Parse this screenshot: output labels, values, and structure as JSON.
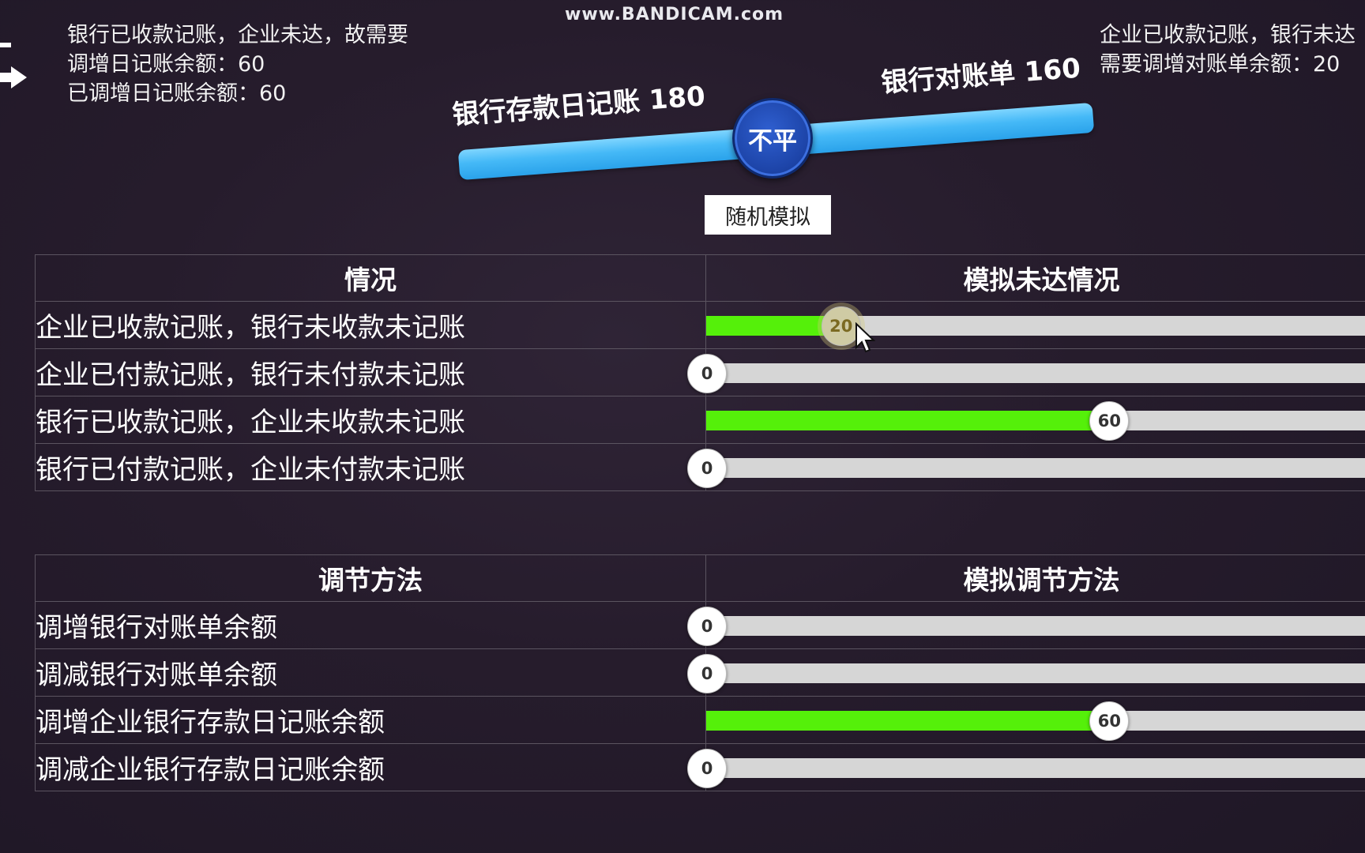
{
  "watermark": "www.BANDICAM.com",
  "info_left": {
    "line1": "银行已收款记账，企业未达，故需要",
    "line2": "调增日记账余额：60",
    "line3": "已调增日记账余额：60"
  },
  "info_right": {
    "line1": "企业已收款记账，银行未达",
    "line2": "需要调增对账单余额：20"
  },
  "scale": {
    "left_label": "银行存款日记账 180",
    "right_label": "银行对账单 160",
    "status": "不平"
  },
  "random_button": "随机模拟",
  "situation_panel": {
    "header_left": "情况",
    "header_right": "模拟未达情况",
    "slider_max": 100,
    "rows": [
      {
        "label": "企业已收款记账，银行未收款未记账",
        "value": 20,
        "value_label": "20"
      },
      {
        "label": "企业已付款记账，银行未付款未记账",
        "value": 0,
        "value_label": "0"
      },
      {
        "label": "银行已收款记账，企业未收款未记账",
        "value": 60,
        "value_label": "60"
      },
      {
        "label": "银行已付款记账，企业未付款未记账",
        "value": 0,
        "value_label": "0"
      }
    ]
  },
  "method_panel": {
    "header_left": "调节方法",
    "header_right": "模拟调节方法",
    "slider_max": 100,
    "rows": [
      {
        "label": "调增银行对账单余额",
        "value": 0,
        "value_label": "0"
      },
      {
        "label": "调减银行对账单余额",
        "value": 0,
        "value_label": "0"
      },
      {
        "label": "调增企业银行存款日记账余额",
        "value": 60,
        "value_label": "60"
      },
      {
        "label": "调减企业银行存款日记账余额",
        "value": 0,
        "value_label": "0"
      }
    ]
  },
  "colors": {
    "fill": "#55f00a",
    "track": "#d6d6d6",
    "beam": "#45b9f7",
    "status_circle": "#1d44a8"
  }
}
